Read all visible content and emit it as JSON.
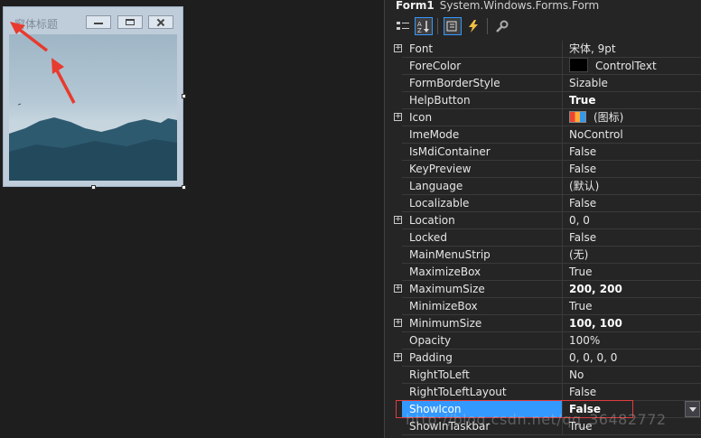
{
  "designer": {
    "form_title": "窗体标题"
  },
  "props": {
    "object_name": "Form1",
    "object_type": "System.Windows.Forms.Form",
    "toolbar": [
      "categorized-icon",
      "alphabetical-icon",
      "properties-icon",
      "events-icon",
      "property-pages-icon"
    ],
    "rows": [
      {
        "name": "Font",
        "value": "宋体, 9pt",
        "expandable": true
      },
      {
        "name": "ForeColor",
        "value": "ControlText",
        "swatch": "#000000"
      },
      {
        "name": "FormBorderStyle",
        "value": "Sizable"
      },
      {
        "name": "HelpButton",
        "value": "True",
        "bold": true
      },
      {
        "name": "Icon",
        "value": "(图标)",
        "expandable": true,
        "icon": true
      },
      {
        "name": "ImeMode",
        "value": "NoControl"
      },
      {
        "name": "IsMdiContainer",
        "value": "False"
      },
      {
        "name": "KeyPreview",
        "value": "False"
      },
      {
        "name": "Language",
        "value": "(默认)"
      },
      {
        "name": "Localizable",
        "value": "False"
      },
      {
        "name": "Location",
        "value": "0, 0",
        "expandable": true
      },
      {
        "name": "Locked",
        "value": "False"
      },
      {
        "name": "MainMenuStrip",
        "value": "(无)"
      },
      {
        "name": "MaximizeBox",
        "value": "True"
      },
      {
        "name": "MaximumSize",
        "value": "200, 200",
        "expandable": true,
        "bold": true
      },
      {
        "name": "MinimizeBox",
        "value": "True"
      },
      {
        "name": "MinimumSize",
        "value": "100, 100",
        "expandable": true,
        "bold": true
      },
      {
        "name": "Opacity",
        "value": "100%"
      },
      {
        "name": "Padding",
        "value": "0, 0, 0, 0",
        "expandable": true
      },
      {
        "name": "RightToLeft",
        "value": "No"
      },
      {
        "name": "RightToLeftLayout",
        "value": "False"
      },
      {
        "name": "ShowIcon",
        "value": "False",
        "bold": true,
        "selected": true
      },
      {
        "name": "ShowInTaskbar",
        "value": "True"
      }
    ],
    "watermark": "http://blog.csdn.net/qq_36482772"
  },
  "colors": {
    "selection": "#3399ff",
    "annotation": "#e03c3c"
  }
}
